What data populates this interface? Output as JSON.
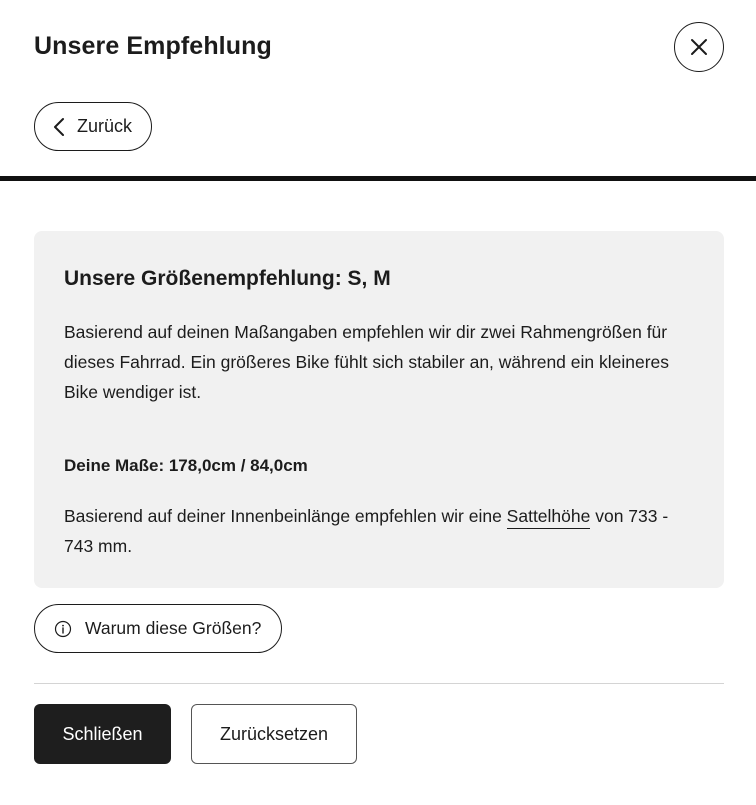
{
  "header": {
    "title": "Unsere Empfehlung",
    "close_icon": "close-icon"
  },
  "back": {
    "label": "Zurück",
    "icon": "chevron-left-icon"
  },
  "recommendation": {
    "title": "Unsere Größenempfehlung: S, M",
    "description": "Basierend auf deinen Maßangaben empfehlen wir dir zwei Rahmengrößen für dieses Fahrrad. Ein größeres Bike fühlt sich stabiler an, während ein kleineres Bike wendiger ist.",
    "measurements": "Deine Maße: 178,0cm / 84,0cm",
    "saddle_prefix": "Basierend auf deiner Innenbeinlänge empfehlen wir eine ",
    "saddle_link": "Sattelhöhe",
    "saddle_suffix": " von 733 - 743 mm."
  },
  "why_button": {
    "label": "Warum diese Größen?",
    "icon": "info-icon"
  },
  "actions": {
    "close_label": "Schließen",
    "reset_label": "Zurücksetzen"
  },
  "colors": {
    "text": "#1c1c1c",
    "card_bg": "#f1f1f1",
    "primary_button": "#1e1e1e",
    "divider": "#111111"
  }
}
